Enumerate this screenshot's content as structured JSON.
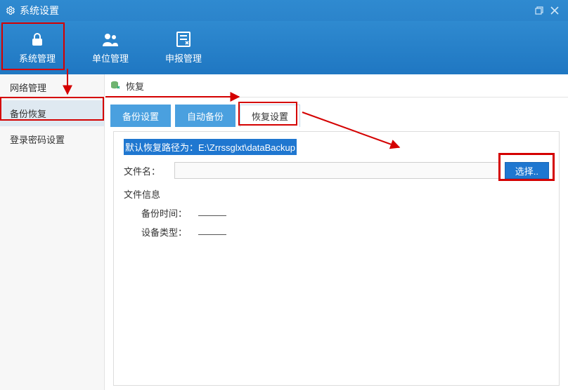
{
  "title": "系统设置",
  "window_buttons": {
    "restore": "restore-icon",
    "close": "close-icon"
  },
  "toolbar": {
    "items": [
      {
        "id": "system",
        "label": "系统管理",
        "icon": "lock-icon",
        "active": true
      },
      {
        "id": "unit",
        "label": "单位管理",
        "icon": "users-icon",
        "active": false
      },
      {
        "id": "declare",
        "label": "申报管理",
        "icon": "form-icon",
        "active": false
      }
    ]
  },
  "sidebar": {
    "items": [
      {
        "id": "network",
        "label": "网络管理",
        "selected": false
      },
      {
        "id": "backup",
        "label": "备份恢复",
        "selected": true
      },
      {
        "id": "pwd",
        "label": "登录密码设置",
        "selected": false
      }
    ]
  },
  "crumb": {
    "icon": "restore-db-icon",
    "label": "恢复"
  },
  "tabs": [
    {
      "id": "backup-setting",
      "label": "备份设置",
      "active": false
    },
    {
      "id": "auto-backup",
      "label": "自动备份",
      "active": false
    },
    {
      "id": "restore-setting",
      "label": "恢复设置",
      "active": true
    }
  ],
  "panel": {
    "default_path_text": "默认恢复路径为：E:\\Zrrssglxt\\dataBackup",
    "file_label": "文件名：",
    "file_value": "",
    "choose_btn": "选择..",
    "file_info_title": "文件信息",
    "rows": [
      {
        "label": "备份时间：",
        "value": "——"
      },
      {
        "label": "设备类型：",
        "value": "——"
      }
    ]
  },
  "colors": {
    "brand": "#1f77d0",
    "highlight_red": "#d40000"
  }
}
